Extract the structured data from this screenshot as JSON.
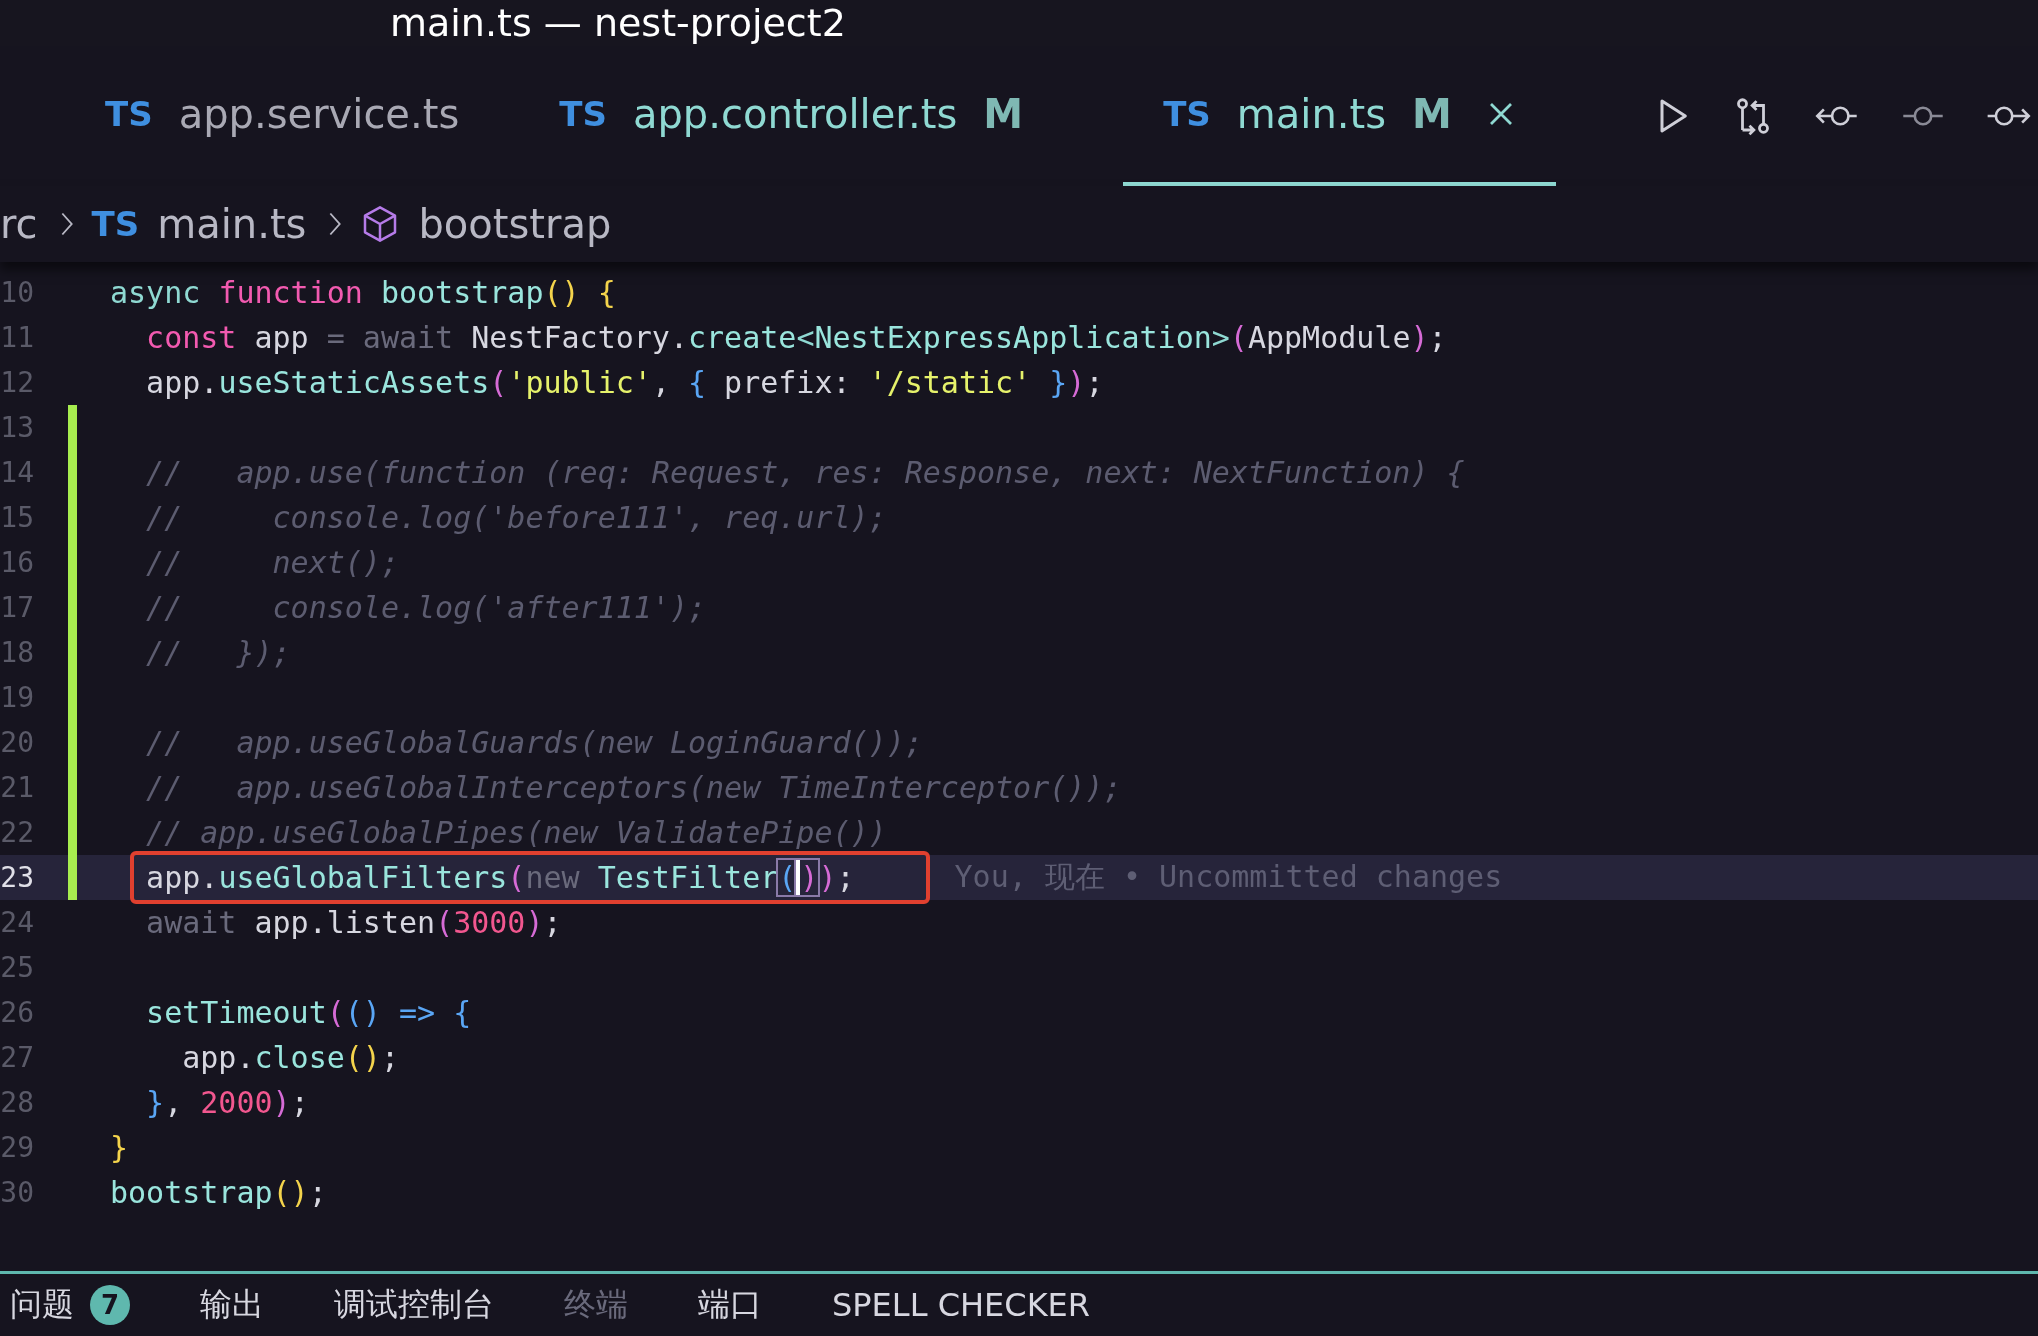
{
  "window": {
    "title": "main.ts — nest-project2"
  },
  "tabs": [
    {
      "badge": "TS",
      "label": "app.service.ts",
      "modified": false,
      "selected": false
    },
    {
      "badge": "TS",
      "label": "app.controller.ts",
      "status": "M",
      "modified": true,
      "selected": false
    },
    {
      "badge": "TS",
      "label": "main.ts",
      "status": "M",
      "modified": true,
      "selected": true
    }
  ],
  "breadcrumb": [
    {
      "kind": "folder",
      "label": "rc"
    },
    {
      "kind": "file",
      "badge": "TS",
      "label": "main.ts"
    },
    {
      "kind": "symbol",
      "label": "bootstrap"
    }
  ],
  "editor": {
    "lines": [
      {
        "number": "10",
        "added": false,
        "current": false,
        "tokens": [
          {
            "kind": "kw",
            "text": "async "
          },
          {
            "kind": "fn2",
            "text": "function "
          },
          {
            "kind": "fn",
            "text": "bootstrap"
          },
          {
            "kind": "br",
            "text": "() "
          },
          {
            "kind": "br",
            "text": "{"
          }
        ]
      },
      {
        "number": "11",
        "added": false,
        "current": false,
        "tokens": [
          {
            "kind": "fn2",
            "text": "  const "
          },
          {
            "kind": "p",
            "text": "app "
          },
          {
            "kind": "dim",
            "text": "= await "
          },
          {
            "kind": "p",
            "text": "NestFactory."
          },
          {
            "kind": "fn",
            "text": "create"
          },
          {
            "kind": "kw",
            "text": "<"
          },
          {
            "kind": "fn",
            "text": "NestExpressApplication"
          },
          {
            "kind": "kw",
            "text": ">"
          },
          {
            "kind": "pa",
            "text": "("
          },
          {
            "kind": "p",
            "text": "AppModule"
          },
          {
            "kind": "pa",
            "text": ")"
          },
          {
            "kind": "p",
            "text": ";"
          }
        ]
      },
      {
        "number": "12",
        "added": false,
        "current": false,
        "tokens": [
          {
            "kind": "p",
            "text": "  app."
          },
          {
            "kind": "fn",
            "text": "useStaticAssets"
          },
          {
            "kind": "pa",
            "text": "("
          },
          {
            "kind": "str",
            "text": "'public'"
          },
          {
            "kind": "p",
            "text": ", "
          },
          {
            "kind": "bl",
            "text": "{"
          },
          {
            "kind": "p",
            "text": " prefix: "
          },
          {
            "kind": "str",
            "text": "'/static' "
          },
          {
            "kind": "bl",
            "text": "}"
          },
          {
            "kind": "pa",
            "text": ")"
          },
          {
            "kind": "p",
            "text": ";"
          }
        ]
      },
      {
        "number": "13",
        "added": true,
        "current": false
      },
      {
        "number": "14",
        "added": true,
        "current": false,
        "tokens": [
          {
            "kind": "cm",
            "text": "  //   app.use(function (req: Request, res: Response, next: NextFunction) {"
          }
        ]
      },
      {
        "number": "15",
        "added": true,
        "current": false,
        "tokens": [
          {
            "kind": "cm",
            "text": "  //     console.log('before111', req.url);"
          }
        ]
      },
      {
        "number": "16",
        "added": true,
        "current": false,
        "tokens": [
          {
            "kind": "cm",
            "text": "  //     next();"
          }
        ]
      },
      {
        "number": "17",
        "added": true,
        "current": false,
        "tokens": [
          {
            "kind": "cm",
            "text": "  //     console.log('after111');"
          }
        ]
      },
      {
        "number": "18",
        "added": true,
        "current": false,
        "tokens": [
          {
            "kind": "cm",
            "text": "  //   });"
          }
        ]
      },
      {
        "number": "19",
        "added": true,
        "current": false
      },
      {
        "number": "20",
        "added": true,
        "current": false,
        "tokens": [
          {
            "kind": "cm",
            "text": "  //   app.useGlobalGuards(new LoginGuard());"
          }
        ]
      },
      {
        "number": "21",
        "added": true,
        "current": false,
        "tokens": [
          {
            "kind": "cm",
            "text": "  //   app.useGlobalInterceptors(new TimeInterceptor());"
          }
        ]
      },
      {
        "number": "22",
        "added": true,
        "current": false,
        "tokens": [
          {
            "kind": "cm",
            "text": "  // app.useGlobalPipes(new ValidatePipe())"
          }
        ]
      },
      {
        "number": "23",
        "added": true,
        "current": true,
        "boxed": true,
        "blame": "You, 现在 • Uncommitted changes",
        "tokens": [
          {
            "kind": "p",
            "text": "  app."
          },
          {
            "kind": "fn",
            "text": "useGlobalFilters"
          },
          {
            "kind": "pa",
            "text": "("
          },
          {
            "kind": "dim",
            "text": "new "
          },
          {
            "kind": "fn",
            "text": "TestFilter"
          },
          {
            "kind": "match",
            "text": "("
          },
          {
            "kind": "caret",
            "text": ")"
          },
          {
            "kind": "pa",
            "text": ")"
          },
          {
            "kind": "p",
            "text": ";"
          }
        ]
      },
      {
        "number": "24",
        "added": false,
        "current": false,
        "tokens": [
          {
            "kind": "dim",
            "text": "  await "
          },
          {
            "kind": "p",
            "text": "app.listen"
          },
          {
            "kind": "pa",
            "text": "("
          },
          {
            "kind": "num",
            "text": "3000"
          },
          {
            "kind": "pa",
            "text": ")"
          },
          {
            "kind": "p",
            "text": ";"
          }
        ]
      },
      {
        "number": "25",
        "added": false,
        "current": false
      },
      {
        "number": "26",
        "added": false,
        "current": false,
        "tokens": [
          {
            "kind": "fn",
            "text": "  setTimeout"
          },
          {
            "kind": "pa",
            "text": "("
          },
          {
            "kind": "bl",
            "text": "() "
          },
          {
            "kind": "bl",
            "text": "=> "
          },
          {
            "kind": "bl",
            "text": "{"
          }
        ]
      },
      {
        "number": "27",
        "added": false,
        "current": false,
        "tokens": [
          {
            "kind": "p",
            "text": "    app."
          },
          {
            "kind": "fn",
            "text": "close"
          },
          {
            "kind": "br",
            "text": "()"
          },
          {
            "kind": "p",
            "text": ";"
          }
        ]
      },
      {
        "number": "28",
        "added": false,
        "current": false,
        "tokens": [
          {
            "kind": "bl",
            "text": "  }"
          },
          {
            "kind": "p",
            "text": ", "
          },
          {
            "kind": "num",
            "text": "2000"
          },
          {
            "kind": "pa",
            "text": ")"
          },
          {
            "kind": "p",
            "text": ";"
          }
        ]
      },
      {
        "number": "29",
        "added": false,
        "current": false,
        "tokens": [
          {
            "kind": "br",
            "text": "}"
          }
        ]
      },
      {
        "number": "30",
        "added": false,
        "current": false,
        "tokens": [
          {
            "kind": "fn",
            "text": "bootstrap"
          },
          {
            "kind": "br",
            "text": "()"
          },
          {
            "kind": "p",
            "text": ";"
          }
        ]
      }
    ]
  },
  "panel_tabs": [
    {
      "label": "问题",
      "badge": "7",
      "dim": false
    },
    {
      "label": "输出",
      "dim": false
    },
    {
      "label": "调试控制台",
      "dim": false
    },
    {
      "label": "终端",
      "dim": true
    },
    {
      "label": "端口",
      "dim": false
    },
    {
      "label": "SPELL CHECKER",
      "dim": false
    }
  ]
}
